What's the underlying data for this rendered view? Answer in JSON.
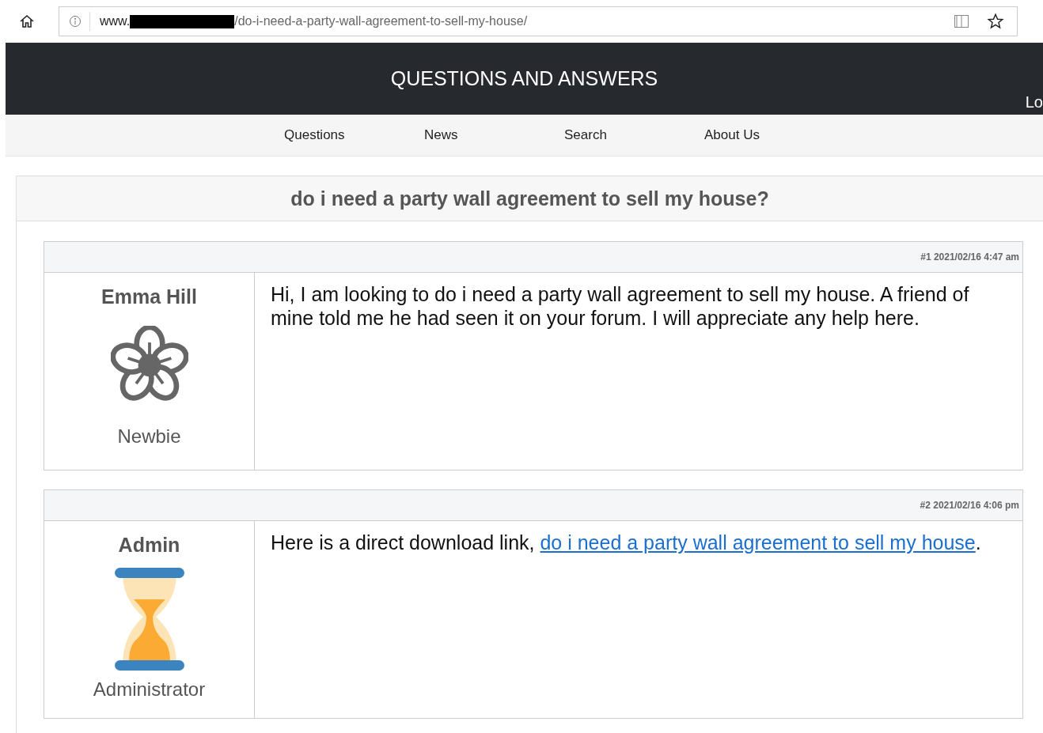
{
  "address_bar": {
    "url_prefix": "www.",
    "redacted": true,
    "url_path": "/do-i-need-a-party-wall-agreement-to-sell-my-house/"
  },
  "header": {
    "title": "QUESTIONS AND ANSWERS",
    "corner_link": "Lo"
  },
  "nav": [
    {
      "label": "Questions"
    },
    {
      "label": "News"
    },
    {
      "label": "Search"
    },
    {
      "label": "About Us"
    }
  ],
  "topic": {
    "title": "do i need a party wall agreement to sell my house?"
  },
  "posts": [
    {
      "meta": "#1 2021/02/16 4:47 am",
      "author": "Emma Hill",
      "kind": "flower",
      "rank": "Newbie",
      "body": [
        {
          "kind": "text",
          "text": "Hi, I am looking to do i need a party wall agreement to sell my house. A friend of mine told me he had seen it on your forum. I will appreciate any help here."
        }
      ]
    },
    {
      "meta": "#2 2021/02/16 4:06 pm",
      "author": "Admin",
      "kind": "hourglass",
      "rank": "Administrator",
      "body": [
        {
          "kind": "text",
          "text": "Here is a direct download link, "
        },
        {
          "kind": "link",
          "text": "do i need a party wall agreement to sell my house"
        },
        {
          "kind": "text",
          "text": "."
        }
      ]
    }
  ]
}
